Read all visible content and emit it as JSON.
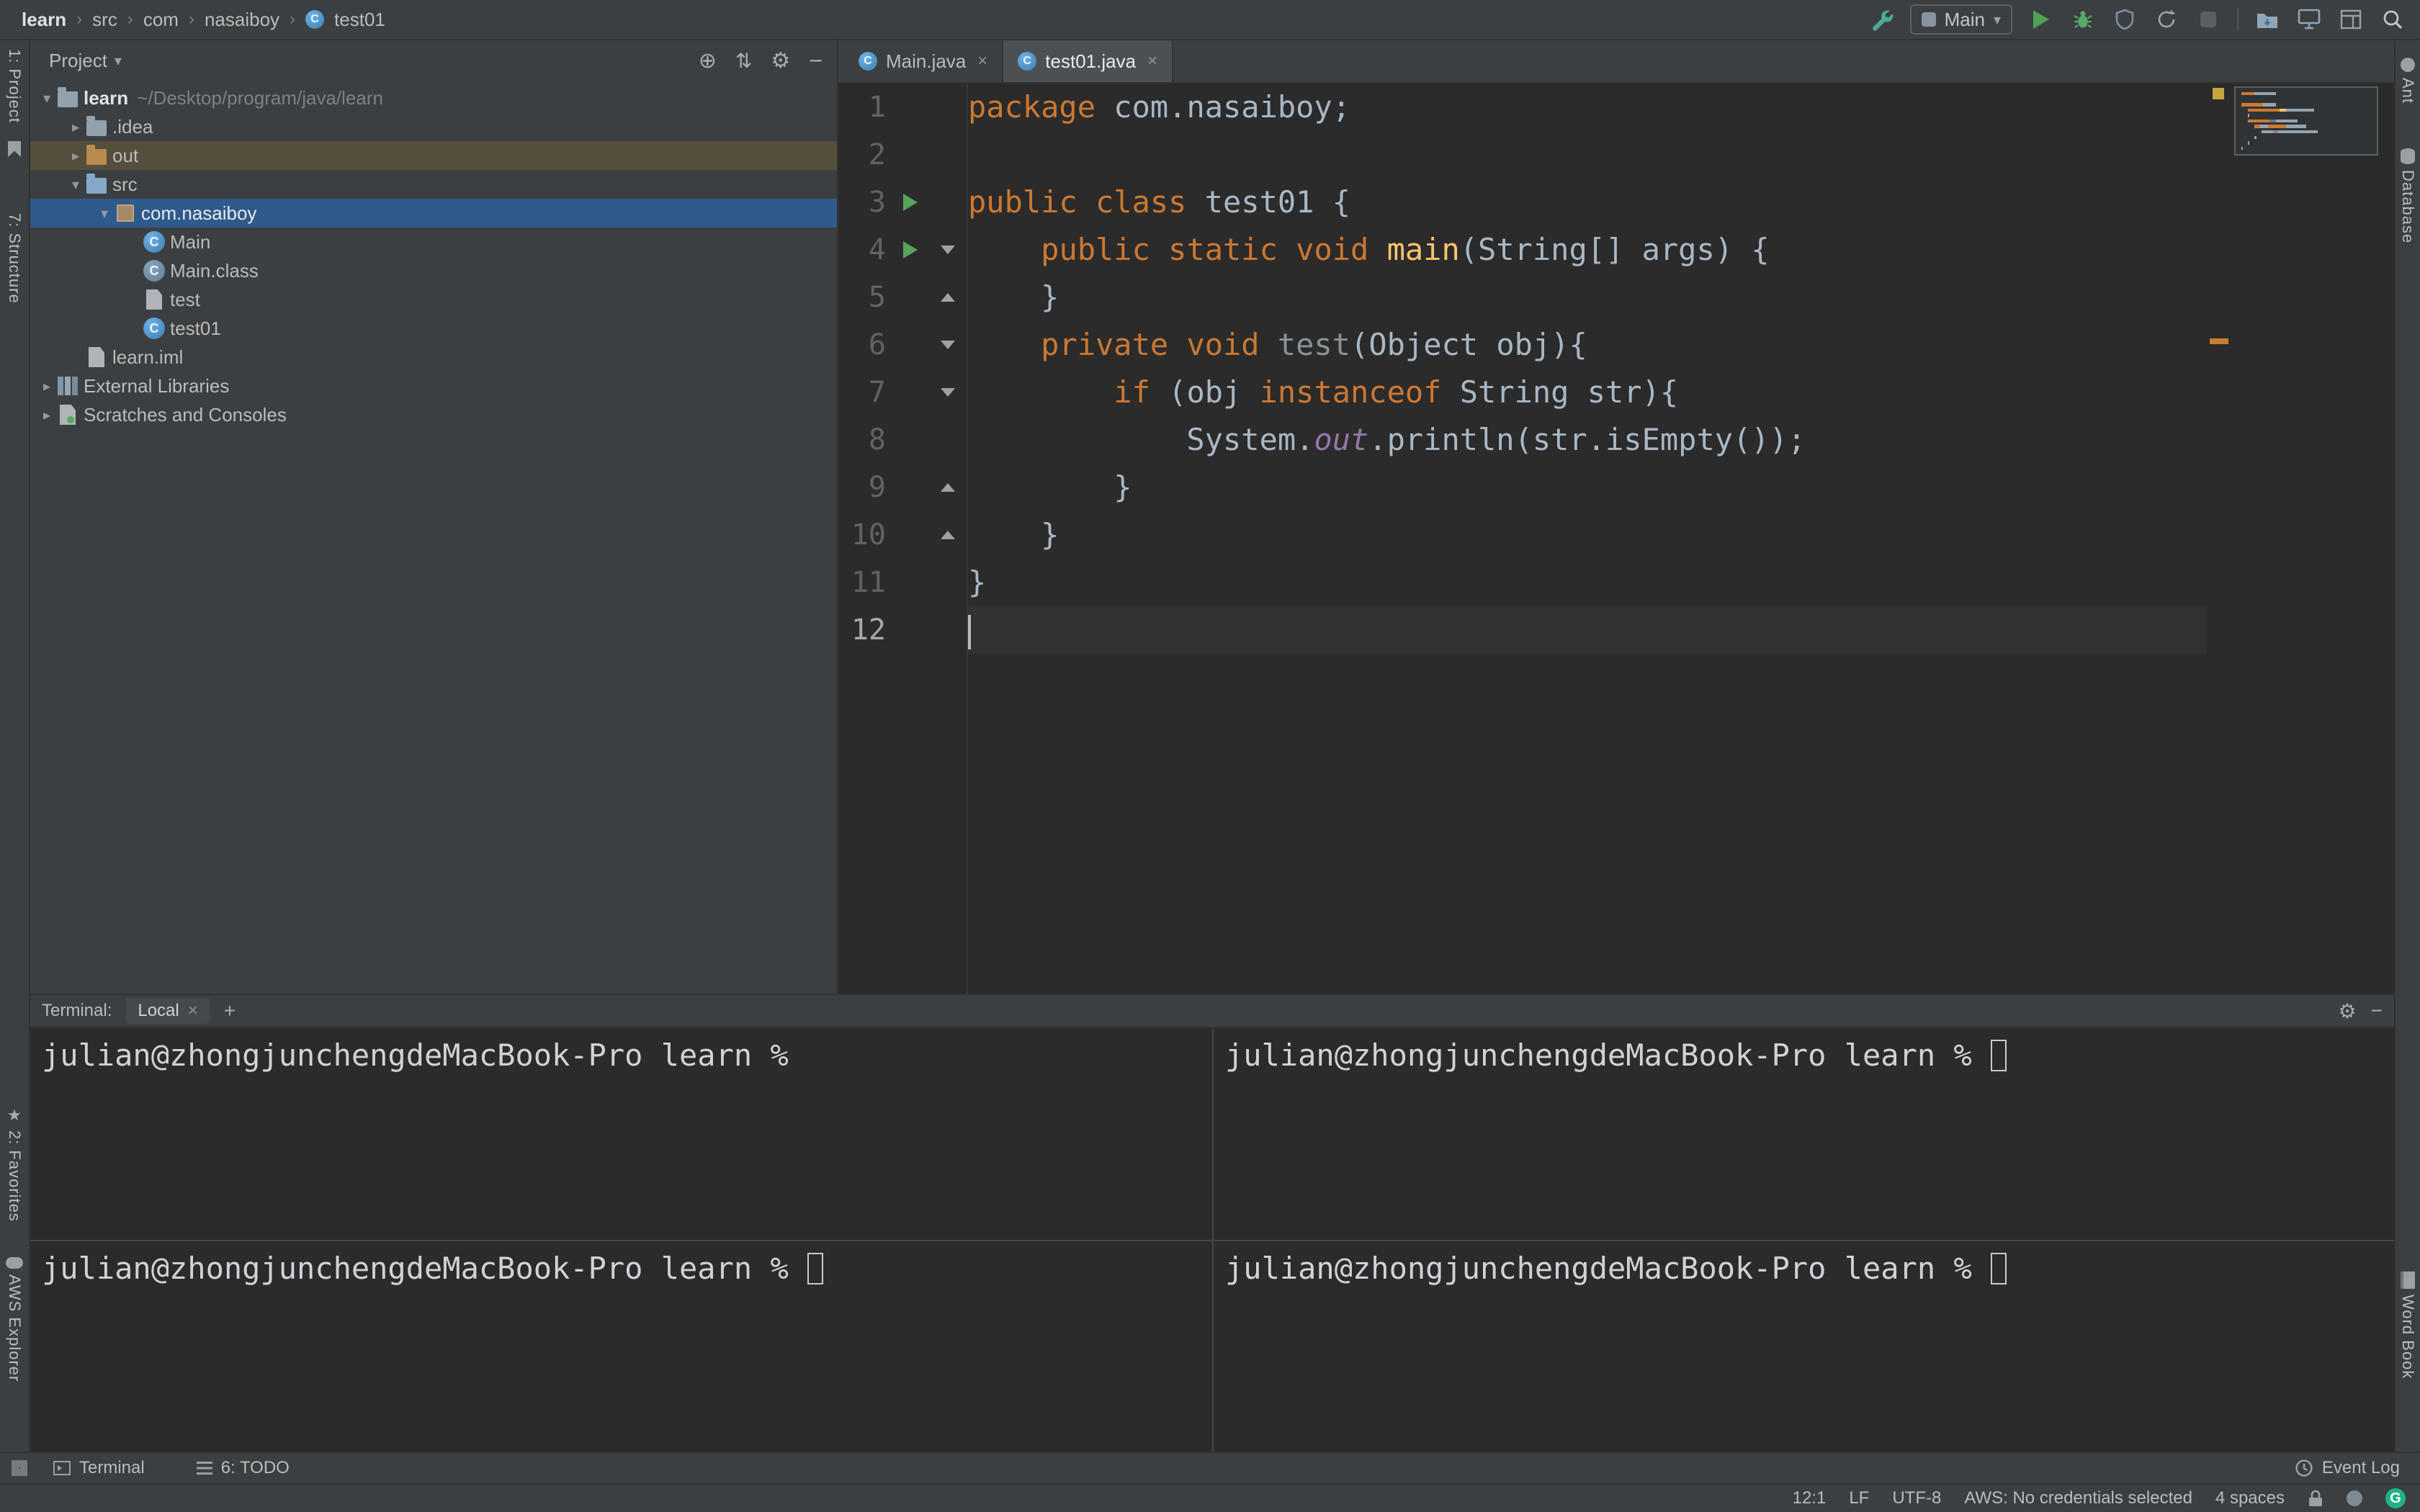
{
  "colors": {
    "keyword": "#cc7832",
    "method": "#ffc66d",
    "field": "#9876aa",
    "plain_text": "#a9b7c6",
    "unused": "#8a9199",
    "selection_blue": "#2e5a8c",
    "drop_highlight": "#564e3c",
    "run_green": "#499c54",
    "warning_mark": "#c7a63f",
    "change_mark": "#c77f32",
    "editor_bg": "#2b2b2b",
    "panel_bg": "#3c3f41"
  },
  "breadcrumbs": {
    "items": [
      "learn",
      "src",
      "com",
      "nasaiboy",
      "test01"
    ]
  },
  "toolbar": {
    "config_name": "Main",
    "icons": [
      "wrench-icon",
      "run-config-select",
      "run-icon",
      "debug-icon",
      "coverage-icon",
      "profiler-icon",
      "stop-icon",
      "folder-arrow-icon",
      "monitor-icon",
      "window-layout-icon",
      "search-icon"
    ]
  },
  "left_stripe": {
    "items": [
      "1: Project",
      "7: Structure",
      "2: Favorites",
      "AWS Explorer"
    ]
  },
  "right_stripe": {
    "items": [
      "Ant",
      "Database",
      "Word Book"
    ]
  },
  "project_panel": {
    "title": "Project",
    "header_icons": [
      "locate-icon",
      "expand-collapse-icon",
      "gear-icon",
      "minimize-icon"
    ],
    "tree": [
      {
        "label": "learn",
        "hint": "~/Desktop/program/java/learn",
        "icon": "folder",
        "indent": 0,
        "arrow": "open",
        "bold": true
      },
      {
        "label": ".idea",
        "icon": "folder",
        "indent": 1,
        "arrow": "closed"
      },
      {
        "label": "out",
        "icon": "folder-excluded",
        "indent": 1,
        "arrow": "closed",
        "highlight": "drop"
      },
      {
        "label": "src",
        "icon": "folder-src",
        "indent": 1,
        "arrow": "open"
      },
      {
        "label": "com.nasaiboy",
        "icon": "package",
        "indent": 2,
        "arrow": "open",
        "selected": true
      },
      {
        "label": "Main",
        "icon": "class",
        "indent": 3
      },
      {
        "label": "Main.class",
        "icon": "class-file",
        "indent": 3
      },
      {
        "label": "test",
        "icon": "file",
        "indent": 3
      },
      {
        "label": "test01",
        "icon": "class",
        "indent": 3
      },
      {
        "label": "learn.iml",
        "icon": "file",
        "indent": 1
      },
      {
        "label": "External Libraries",
        "icon": "library",
        "indent": 0,
        "arrow": "closed"
      },
      {
        "label": "Scratches and Consoles",
        "icon": "scratches",
        "indent": 0,
        "arrow": "closed"
      }
    ]
  },
  "editor": {
    "tabs": [
      {
        "label": "Main.java",
        "active": false
      },
      {
        "label": "test01.java",
        "active": true
      }
    ],
    "lines": [
      {
        "n": 1,
        "tokens": [
          {
            "t": "package ",
            "c": "kw"
          },
          {
            "t": "com.nasaiboy;",
            "c": "pl"
          }
        ]
      },
      {
        "n": 2,
        "tokens": []
      },
      {
        "n": 3,
        "run": true,
        "tokens": [
          {
            "t": "public class ",
            "c": "kw"
          },
          {
            "t": "test01 {",
            "c": "pl"
          }
        ]
      },
      {
        "n": 4,
        "run": true,
        "fold": "down",
        "tokens": [
          {
            "t": "    ",
            "c": "pl"
          },
          {
            "t": "public static void ",
            "c": "kw"
          },
          {
            "t": "main",
            "c": "method"
          },
          {
            "t": "(String[] args) {",
            "c": "pl"
          }
        ]
      },
      {
        "n": 5,
        "fold": "up",
        "tokens": [
          {
            "t": "    }",
            "c": "pl"
          }
        ]
      },
      {
        "n": 6,
        "fold": "down",
        "tokens": [
          {
            "t": "    ",
            "c": "pl"
          },
          {
            "t": "private void ",
            "c": "kw"
          },
          {
            "t": "test",
            "c": "unused"
          },
          {
            "t": "(Object obj){",
            "c": "pl"
          }
        ]
      },
      {
        "n": 7,
        "fold": "down",
        "tokens": [
          {
            "t": "        ",
            "c": "pl"
          },
          {
            "t": "if ",
            "c": "kw"
          },
          {
            "t": "(obj ",
            "c": "pl"
          },
          {
            "t": "instanceof ",
            "c": "kw"
          },
          {
            "t": "String str){",
            "c": "pl"
          }
        ]
      },
      {
        "n": 8,
        "tokens": [
          {
            "t": "            System.",
            "c": "pl"
          },
          {
            "t": "out",
            "c": "field"
          },
          {
            "t": ".println(str.isEmpty());",
            "c": "pl"
          }
        ]
      },
      {
        "n": 9,
        "fold": "up",
        "tokens": [
          {
            "t": "        }",
            "c": "pl"
          }
        ]
      },
      {
        "n": 10,
        "fold": "up",
        "tokens": [
          {
            "t": "    }",
            "c": "pl"
          }
        ]
      },
      {
        "n": 11,
        "tokens": [
          {
            "t": "}",
            "c": "pl"
          }
        ]
      },
      {
        "n": 12,
        "current": true,
        "tokens": []
      }
    ],
    "stripe_marks": [
      {
        "type": "warning",
        "color": "#c7a63f"
      },
      {
        "type": "change",
        "color": "#c77f32"
      }
    ]
  },
  "terminal": {
    "label": "Terminal:",
    "tab": "Local",
    "panes": [
      {
        "prompt": "julian@zhongjunchengdeMacBook-Pro learn %",
        "cursor": false
      },
      {
        "prompt": "julian@zhongjunchengdeMacBook-Pro learn %",
        "cursor": true
      },
      {
        "prompt": "julian@zhongjunchengdeMacBook-Pro learn %",
        "cursor": true
      },
      {
        "prompt": "julian@zhongjunchengdeMacBook-Pro learn %",
        "cursor": true
      }
    ]
  },
  "bottom_stripe": {
    "terminal": "Terminal",
    "todo": "6: TODO",
    "event_log": "Event Log"
  },
  "status_bar": {
    "caret_position": "12:1",
    "line_separator": "LF",
    "encoding": "UTF-8",
    "aws": "AWS: No credentials selected",
    "indent": "4 spaces"
  }
}
